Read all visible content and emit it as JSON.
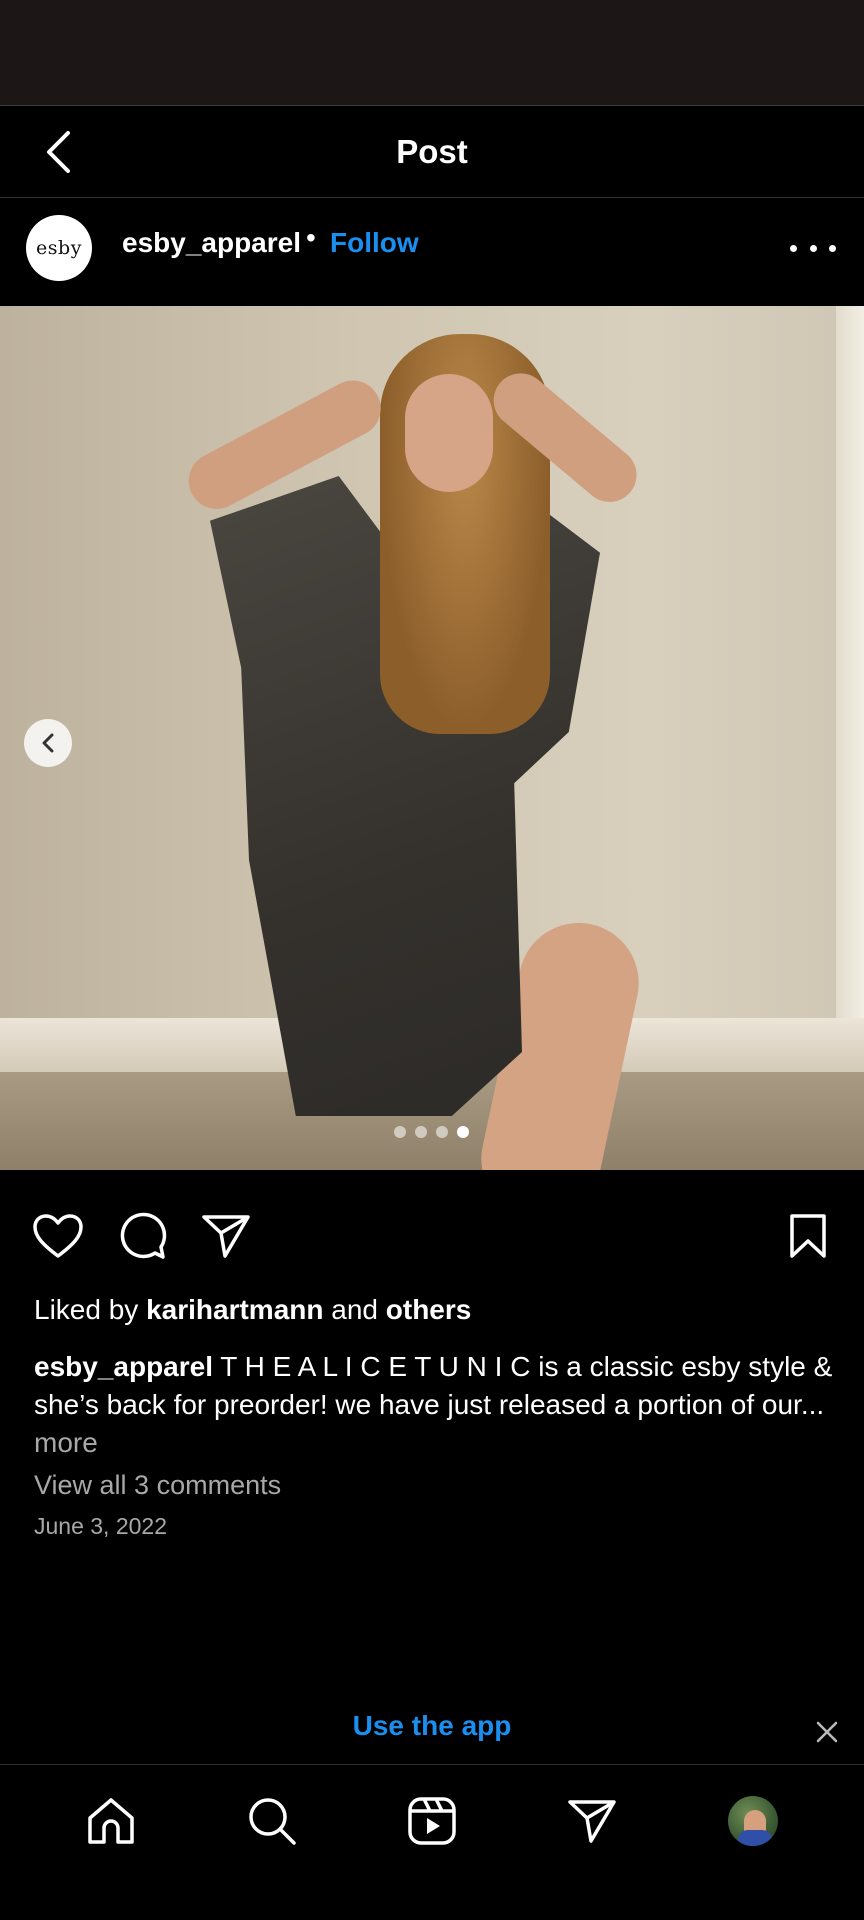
{
  "header": {
    "title": "Post"
  },
  "post": {
    "avatar_text": "esby",
    "username": "esby_apparel",
    "separator": "•",
    "follow_label": "Follow",
    "carousel": {
      "total_slides": 4,
      "current_slide": 4
    }
  },
  "engagement": {
    "liked_prefix": "Liked by",
    "liked_user": "karihartmann",
    "liked_and": "and",
    "liked_others": "others"
  },
  "caption": {
    "username": "esby_apparel",
    "text": "T H E A L I C E T U N I C is a classic esby style & she’s back for preorder! we have just released a portion of our...",
    "more_label": "more"
  },
  "comments": {
    "view_all_label": "View all 3 comments"
  },
  "date": "June 3, 2022",
  "banner": {
    "use_app_label": "Use the app"
  },
  "icons": {
    "back": "chevron-left-icon",
    "more": "more-horizontal-icon",
    "like": "heart-icon",
    "comment": "comment-icon",
    "share": "send-icon",
    "save": "bookmark-icon",
    "close": "close-icon",
    "home": "home-icon",
    "search": "search-icon",
    "reels": "reels-icon",
    "messages": "send-icon"
  },
  "colors": {
    "accent": "#1a8ff0",
    "background": "#000000",
    "status_bar": "#1c1617",
    "secondary_text": "#a8a8a8"
  }
}
